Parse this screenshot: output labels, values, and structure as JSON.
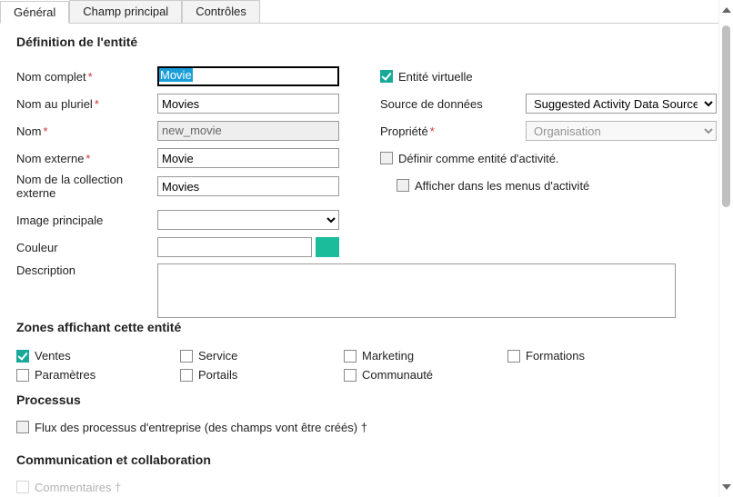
{
  "tabs": {
    "general": "Général",
    "main_field": "Champ principal",
    "controls": "Contrôles"
  },
  "sections": {
    "entity_def": "Définition de l'entité",
    "zones": "Zones affichant cette entité",
    "process": "Processus",
    "comm": "Communication et collaboration"
  },
  "labels": {
    "display_name": "Nom complet",
    "plural_name": "Nom au pluriel",
    "name": "Nom",
    "external_name": "Nom externe",
    "external_collection": "Nom de la collection externe",
    "primary_image": "Image principale",
    "color": "Couleur",
    "description": "Description",
    "virtual_entity": "Entité virtuelle",
    "data_source": "Source de données",
    "ownership": "Propriété",
    "define_activity": "Définir comme entité d'activité.",
    "show_activity_menus": "Afficher dans les menus d'activité"
  },
  "values": {
    "display_name": "Movie",
    "plural_name": "Movies",
    "name": "new_movie",
    "external_name": "Movie",
    "external_collection": "Movies",
    "data_source": "Suggested Activity Data Source",
    "ownership": "Organisation",
    "color_hex": "#1abc9c"
  },
  "zones": {
    "sales": "Ventes",
    "service": "Service",
    "marketing": "Marketing",
    "training": "Formations",
    "settings": "Paramètres",
    "portals": "Portails",
    "community": "Communauté"
  },
  "process": {
    "bpf": "Flux des processus d'entreprise (des champs vont être créés) †"
  },
  "comm_items": {
    "comments": "Commentaires †"
  }
}
